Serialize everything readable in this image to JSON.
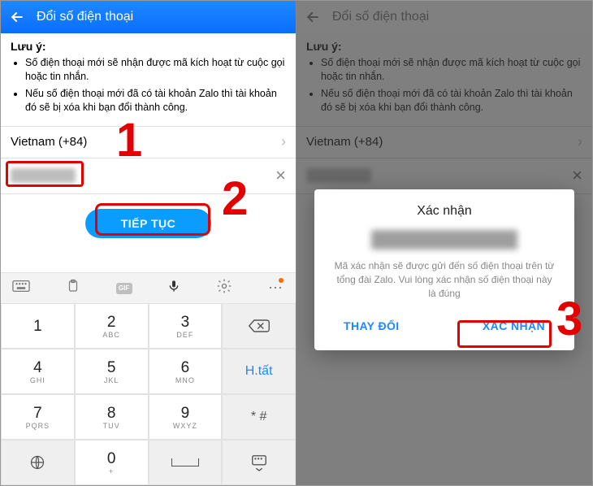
{
  "left": {
    "header_title": "Đổi số điện thoại",
    "notice_title": "Lưu ý:",
    "notice_items": [
      "Số điện thoại mới sẽ nhận được mã kích hoạt từ cuộc gọi hoặc tin nhắn.",
      "Nếu số điện thoại mới đã có tài khoản Zalo thì tài khoản đó sẽ bị xóa khi bạn đổi thành công."
    ],
    "country_label": "Vietnam (+84)",
    "continue_label": "TIẾP TỤC",
    "keys": {
      "k1d": "1",
      "k1s": "",
      "k2d": "2",
      "k2s": "ABC",
      "k3d": "3",
      "k3s": "DEF",
      "k4d": "4",
      "k4s": "GHI",
      "k5d": "5",
      "k5s": "JKL",
      "k6d": "6",
      "k6s": "MNO",
      "k7d": "7",
      "k7s": "PQRS",
      "k8d": "8",
      "k8s": "TUV",
      "k9d": "9",
      "k9s": "WXYZ",
      "kstar": "* #",
      "k0d": "0",
      "k0s": "+",
      "kdone": "H.tất",
      "gif": "GIF"
    }
  },
  "right": {
    "header_title": "Đổi số điện thoại",
    "notice_title": "Lưu ý:",
    "notice_items": [
      "Số điện thoại mới sẽ nhận được mã kích hoạt từ cuộc gọi hoặc tin nhắn.",
      "Nếu số điện thoại mới đã có tài khoản Zalo thì tài khoản đó sẽ bị xóa khi bạn đổi thành công."
    ],
    "country_label": "Vietnam (+84)",
    "dialog": {
      "title": "Xác nhận",
      "message": "Mã xác nhận sẽ được gửi đến số điện thoại trên từ tổng đài Zalo. Vui lòng xác nhận số điện thoại này là đúng",
      "change_label": "THAY ĐỔI",
      "confirm_label": "XÁC NHẬN"
    }
  },
  "callouts": {
    "n1": "1",
    "n2": "2",
    "n3": "3"
  }
}
